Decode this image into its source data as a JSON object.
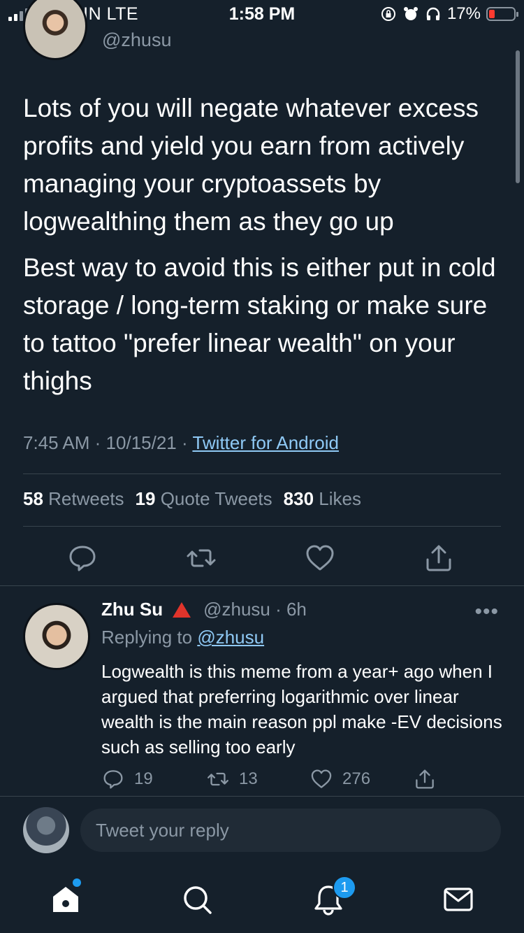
{
  "status_bar": {
    "carrier": "VIRGIN  LTE",
    "time": "1:58 PM",
    "battery_percent": "17%"
  },
  "tweet": {
    "handle": "@zhusu",
    "paragraphs": [
      "Lots of you will negate whatever excess profits and yield you earn from actively managing your cryptoassets by logwealthing them as they go up",
      "Best way to avoid this is either put in cold storage / long-term staking or make sure to tattoo \"prefer linear wealth\" on your thighs"
    ],
    "time": "7:45 AM",
    "date": "10/15/21",
    "separator": "·",
    "source": "Twitter for Android",
    "stats": {
      "retweets_count": "58",
      "retweets_label": "Retweets",
      "quotes_count": "19",
      "quotes_label": "Quote Tweets",
      "likes_count": "830",
      "likes_label": "Likes"
    }
  },
  "reply": {
    "name": "Zhu Su",
    "handle_time": "@zhusu · 6h",
    "replying_prefix": "Replying to",
    "replying_to": "@zhusu",
    "text": "Logwealth is this meme from a year+ ago when I argued that preferring logarithmic over linear wealth is the main reason ppl make -EV decisions such as selling too early",
    "reply_count": "19",
    "retweet_count": "13",
    "like_count": "276",
    "more_label": "•••"
  },
  "compose": {
    "placeholder": "Tweet your reply"
  },
  "nav": {
    "notifications_badge": "1"
  },
  "colors": {
    "background": "#15202b",
    "accent": "#1d9bf0",
    "link": "#8fc9f5",
    "muted": "#8b98a5",
    "divider": "#38444d"
  }
}
